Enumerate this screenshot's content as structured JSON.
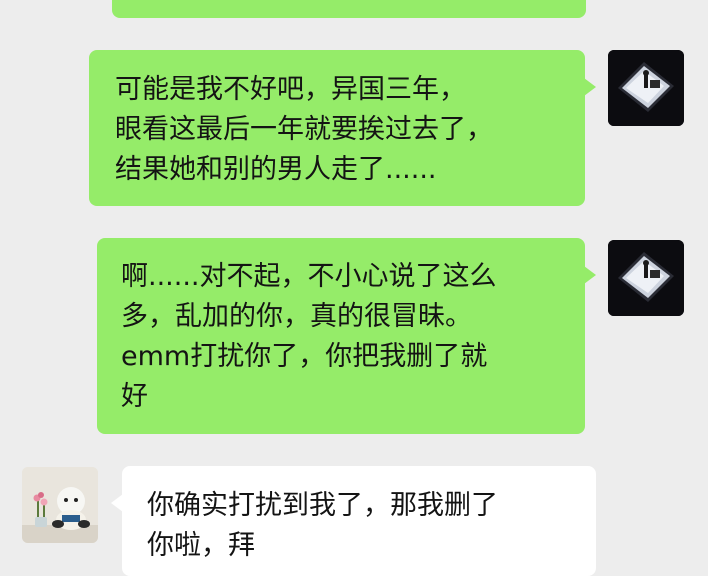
{
  "chat": {
    "messages": [
      {
        "side": "sent",
        "text": ""
      },
      {
        "side": "sent",
        "text": "可能是我不好吧，异国三年，\n眼看这最后一年就要挨过去了，\n结果她和别的男人走了......"
      },
      {
        "side": "sent",
        "text": "啊......对不起，不小心说了这么\n多，乱加的你，真的很冒昧。\nemm打扰你了，你把我删了就\n好"
      },
      {
        "side": "received",
        "text": "你确实打扰到我了，那我删了\n你啦，拜"
      }
    ]
  },
  "avatars": {
    "self_icon": "photo-avatar-icon",
    "other_icon": "plush-toy-avatar-icon"
  },
  "colors": {
    "background": "#ededed",
    "sent_bubble": "#95ec69",
    "received_bubble": "#ffffff",
    "text": "#141414"
  }
}
